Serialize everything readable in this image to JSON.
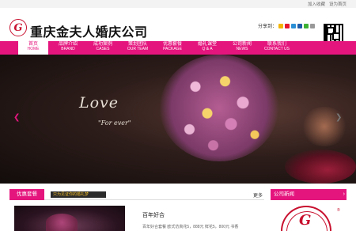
{
  "top": {
    "links": [
      "加入收藏",
      "设为首页"
    ]
  },
  "header": {
    "logo_glyph": "G",
    "brand": "重庆金夫人婚庆公司",
    "share_label": "分享到：",
    "share_icons": [
      {
        "name": "qzone-icon",
        "color": "#f4b400"
      },
      {
        "name": "weibo-icon",
        "color": "#e6162d"
      },
      {
        "name": "tencent-weibo-icon",
        "color": "#2b8fd6"
      },
      {
        "name": "renren-icon",
        "color": "#1f5ba8"
      },
      {
        "name": "wechat-icon",
        "color": "#3eb135"
      },
      {
        "name": "more-share-icon",
        "color": "#999999"
      }
    ]
  },
  "nav": [
    {
      "cn": "首页",
      "en": "HOME",
      "active": true
    },
    {
      "cn": "品牌介绍",
      "en": "BRAND"
    },
    {
      "cn": "成功案例",
      "en": "CASES"
    },
    {
      "cn": "策划团队",
      "en": "OUR TEAM"
    },
    {
      "cn": "优惠套餐",
      "en": "PACKAGE"
    },
    {
      "cn": "婚礼课堂",
      "en": "Q & A"
    },
    {
      "cn": "公司新闻",
      "en": "NEWS"
    },
    {
      "cn": "联系我们",
      "en": "CONTACT US"
    }
  ],
  "banner": {
    "title": "Love",
    "subtitle": "\"For ever\"",
    "prev_glyph": "❮",
    "next_glyph": "❯"
  },
  "packages": {
    "tab": "优惠套餐",
    "sub": "只为见证你的婚礼梦",
    "more": "更多",
    "article_title": "百年好合",
    "article_body": "百年好合套餐 欧式仿真花5，888元 鲜花5，800元 书香"
  },
  "news": {
    "tab": "公司新闻",
    "arrow": "›",
    "logo_glyph": "G",
    "reg": "®"
  },
  "colors": {
    "accent": "#e5157e",
    "logo_red": "#c8102e"
  }
}
